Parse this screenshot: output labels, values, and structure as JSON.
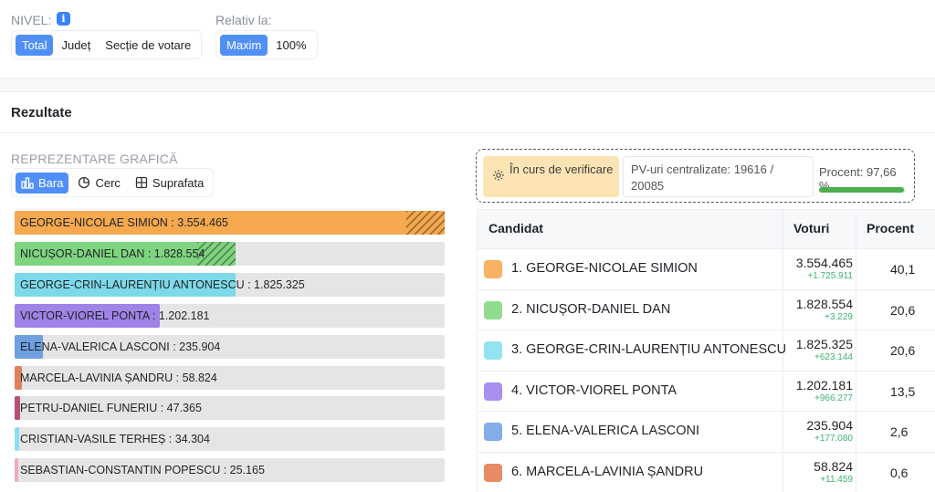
{
  "filters": {
    "nivel_label": "NIVEL:",
    "nivel_info_icon": "info-icon",
    "nivel_options": [
      "Total",
      "Județ",
      "Secție de votare"
    ],
    "nivel_selected": "Total",
    "relativ_label": "Relativ la:",
    "relativ_options": [
      "Maxim",
      "100%"
    ],
    "relativ_selected": "Maxim"
  },
  "results": {
    "title": "Rezultate",
    "representation_label": "REPREZENTARE GRAFICĂ",
    "tabs": [
      {
        "label": "Bara",
        "icon": "bar-chart-icon",
        "active": true
      },
      {
        "label": "Cerc",
        "icon": "pie-chart-icon",
        "active": false
      },
      {
        "label": "Suprafata",
        "icon": "area-grid-icon",
        "active": false
      }
    ]
  },
  "status": {
    "verification": "În curs de verificare",
    "verification_icon": "gear-icon",
    "pv_text": "PV-uri centralizate: 19616 / 20085",
    "percent_text": "Procent: 97,66 %",
    "percent_value": 97.66,
    "progress_color": "#4caf50"
  },
  "chart_data": {
    "type": "bar",
    "categories": [
      "GEORGE-NICOLAE SIMION",
      "NICUȘOR-DANIEL DAN",
      "GEORGE-CRIN-LAURENȚIU ANTONESCU",
      "VICTOR-VIOREL PONTA",
      "ELENA-VALERICA LASCONI",
      "MARCELA-LAVINIA ȘANDRU",
      "PETRU-DANIEL FUNERIU",
      "CRISTIAN-VASILE TERHEȘ",
      "SEBASTIAN-CONSTANTIN POPESCU"
    ],
    "values": [
      3554465,
      1828554,
      1825325,
      1202181,
      235904,
      58824,
      47365,
      34304,
      25165
    ],
    "labels": [
      "GEORGE-NICOLAE SIMION : 3.554.465",
      "NICUȘOR-DANIEL DAN : 1.828.554",
      "GEORGE-CRIN-LAURENȚIU ANTONESCU : 1.825.325",
      "VICTOR-VIOREL PONTA : 1.202.181",
      "ELENA-VALERICA LASCONI : 235.904",
      "MARCELA-LAVINIA ȘANDRU : 58.824",
      "PETRU-DANIEL FUNERIU : 47.365",
      "CRISTIAN-VASILE TERHEȘ : 34.304",
      "SEBASTIAN-CONSTANTIN POPESCU : 25.165"
    ],
    "colors": [
      "#f5a84e",
      "#7fd47f",
      "#7dd9ea",
      "#9f83e6",
      "#6fa0e0",
      "#e0805a",
      "#b8506e",
      "#8fdcf0",
      "#f0a9c6"
    ],
    "hatched": [
      true,
      true,
      false,
      false,
      false,
      false,
      false,
      false,
      false
    ],
    "relative_to": "Maxim"
  },
  "table": {
    "headers": [
      "Candidat",
      "Voturi",
      "Procent"
    ],
    "rows": [
      {
        "name": "1. GEORGE-NICOLAE SIMION",
        "votes": "3.554.465",
        "delta": "+1.725.911",
        "percent": "40,1",
        "color": "#f7b262"
      },
      {
        "name": "2. NICUȘOR-DANIEL DAN",
        "votes": "1.828.554",
        "delta": "+3.229",
        "percent": "20,6",
        "color": "#8fdc8f"
      },
      {
        "name": "3. GEORGE-CRIN-LAURENȚIU ANTONESCU",
        "votes": "1.825.325",
        "delta": "+623.144",
        "percent": "20,6",
        "color": "#93e3f0"
      },
      {
        "name": "4. VICTOR-VIOREL PONTA",
        "votes": "1.202.181",
        "delta": "+966.277",
        "percent": "13,5",
        "color": "#a98ff0"
      },
      {
        "name": "5. ELENA-VALERICA LASCONI",
        "votes": "235.904",
        "delta": "+177.080",
        "percent": "2,6",
        "color": "#82adea"
      },
      {
        "name": "6. MARCELA-LAVINIA ȘANDRU",
        "votes": "58.824",
        "delta": "+11.459",
        "percent": "0,6",
        "color": "#e88a64"
      }
    ]
  }
}
